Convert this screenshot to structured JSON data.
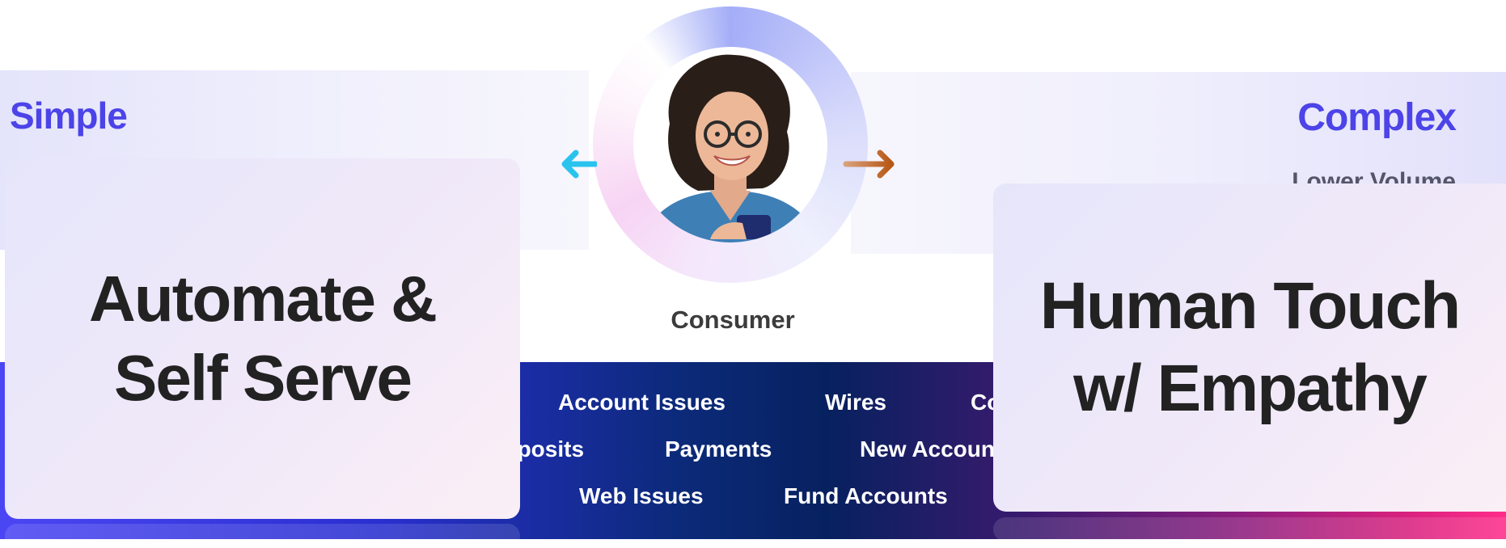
{
  "labels": {
    "simple": "Simple",
    "complex": "Complex",
    "lower_volume": "Lower Volume"
  },
  "consumer": {
    "label": "Consumer"
  },
  "cards": {
    "left": {
      "line1": "Automate &",
      "line2": "Self Serve"
    },
    "right": {
      "line1": "Human Touch",
      "line2": "w/ Empathy"
    }
  },
  "topics": {
    "row1": [
      "Account Issues",
      "Wires",
      "Co"
    ],
    "row2": [
      "eposits",
      "Payments",
      "New Accoun"
    ],
    "row3": [
      "Web Issues",
      "Fund Accounts"
    ]
  },
  "colors": {
    "accent": "#4c43e8",
    "arrow_left": "#29c3ee",
    "arrow_right": "#c2601e",
    "band_left": "#4b46f4",
    "band_mid": "#07215f",
    "band_right": "#ff2d8a"
  },
  "icons": {
    "arrow_left": "arrow-left-icon",
    "arrow_right": "arrow-right-icon",
    "avatar": "consumer-avatar"
  }
}
